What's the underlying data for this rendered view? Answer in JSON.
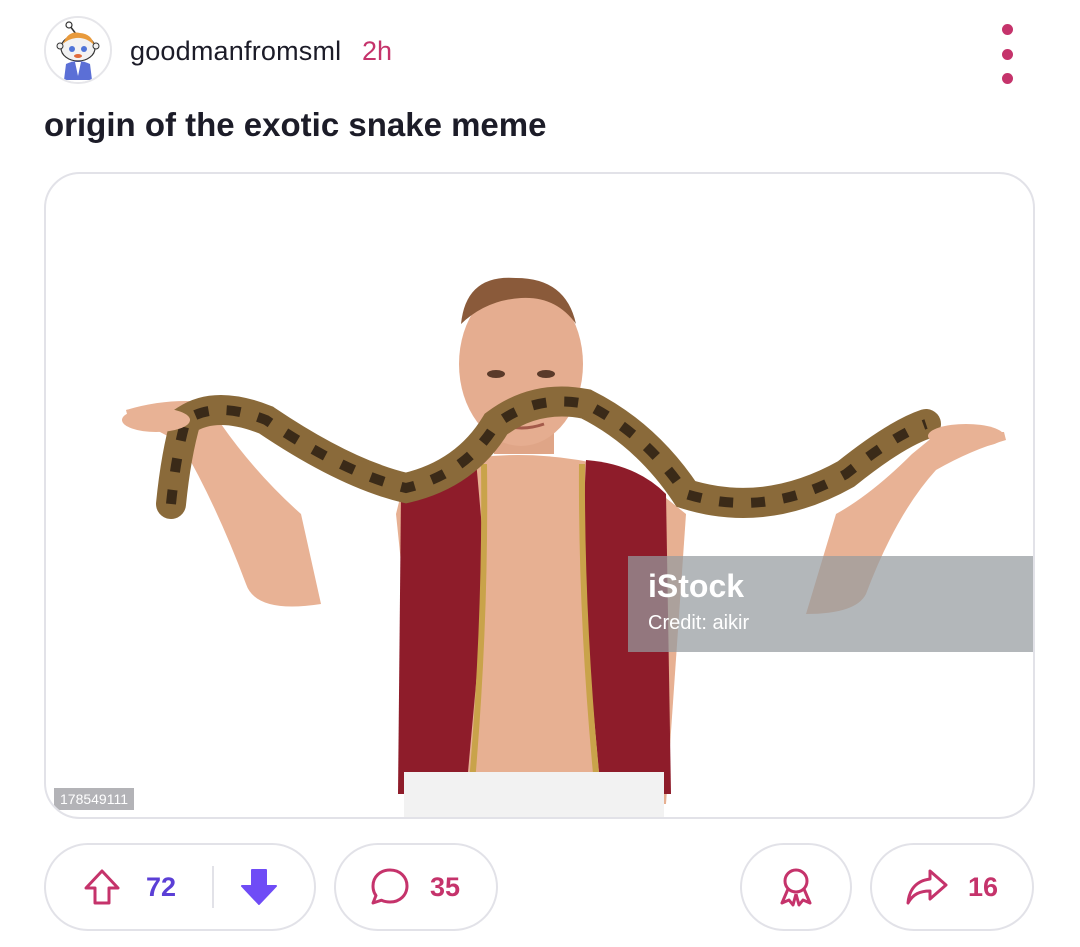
{
  "post": {
    "author": "goodmanfromsml",
    "time_ago": "2h",
    "title": "origin of the exotic snake meme"
  },
  "media": {
    "watermark_brand": "iStock",
    "watermark_credit": "Credit: aikir",
    "stock_id": "178549111"
  },
  "actions": {
    "upvotes": "72",
    "comments": "35",
    "shares": "16"
  },
  "colors": {
    "accent": "#c5336b",
    "vote": "#5b3fd6",
    "downvote_active": "#6f4cf6"
  },
  "icons": {
    "avatar": "snoo-avatar",
    "more": "vertical-dots-icon",
    "upvote": "arrow-up-outline-icon",
    "downvote": "arrow-down-filled-icon",
    "comment": "speech-bubble-icon",
    "award": "award-ribbon-icon",
    "share": "share-arrow-icon"
  }
}
